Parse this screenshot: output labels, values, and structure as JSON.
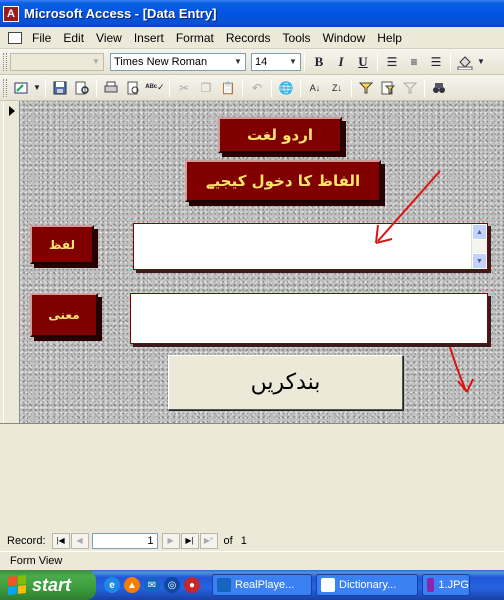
{
  "window": {
    "title": "Microsoft Access - [Data Entry]",
    "app_icon": "A"
  },
  "menu": {
    "items": [
      "File",
      "Edit",
      "View",
      "Insert",
      "Format",
      "Records",
      "Tools",
      "Window",
      "Help"
    ]
  },
  "toolbar_format": {
    "object_combo": "",
    "font_name": "Times New Roman",
    "font_size": "14",
    "bold": "B",
    "italic": "I",
    "underline": "U"
  },
  "form": {
    "title": "اردو لغت",
    "instruction": "الفاظ کا دخول کیجیے",
    "word_label": "لفظ",
    "meaning_label": "معنی",
    "word_value": "",
    "meaning_value": "",
    "close_button": "بندکریں",
    "accent_color": "#800000",
    "label_text_color": "#FFE36B"
  },
  "record_nav": {
    "label": "Record:",
    "current": "1",
    "of_label": "of",
    "total": "1"
  },
  "status": {
    "text": "Form View"
  },
  "taskbar": {
    "start_label": "start",
    "tasks": [
      "RealPlaye...",
      "Dictionary...",
      "1.JPG"
    ]
  }
}
